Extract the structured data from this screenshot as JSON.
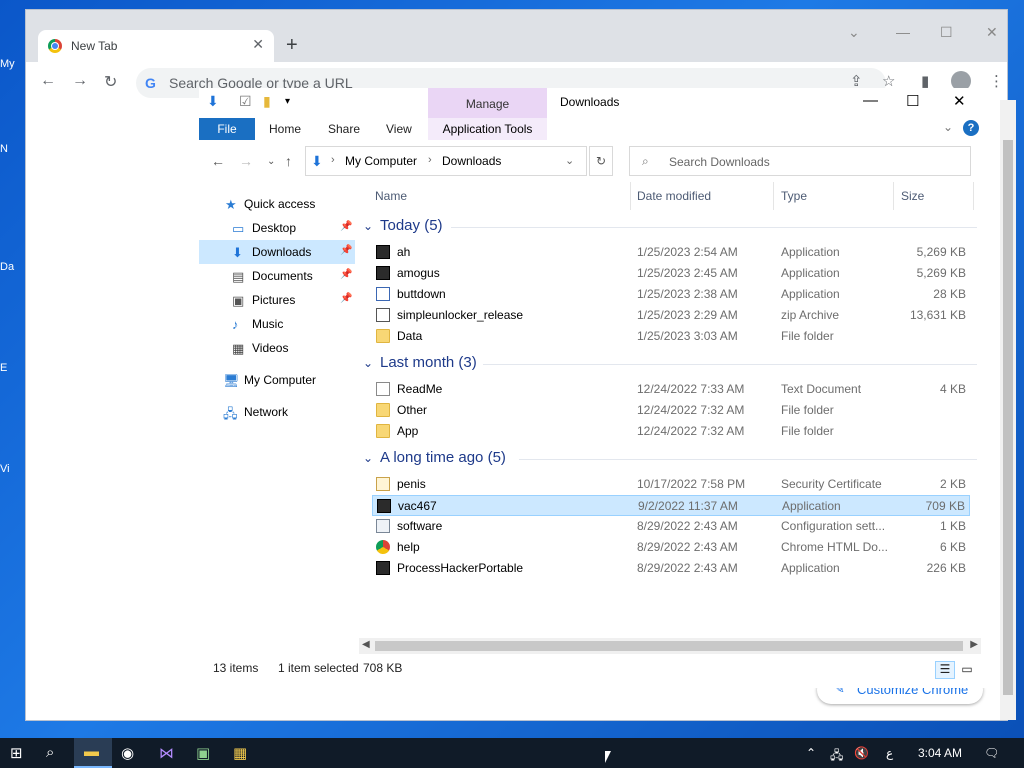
{
  "desktop": {
    "labels": [
      "My",
      "N",
      "Da",
      "E",
      "Vi"
    ]
  },
  "chrome": {
    "tab_title": "New Tab",
    "new_tab": "+",
    "search_placeholder": "Search Google or type a URL",
    "customize": "Customize Chrome"
  },
  "explorer": {
    "title": "Downloads",
    "manage": "Manage",
    "ribbon_tabs": [
      "File",
      "Home",
      "Share",
      "View",
      "Application Tools"
    ],
    "address": [
      "My Computer",
      "Downloads"
    ],
    "search_placeholder": "Search Downloads",
    "nav": [
      {
        "label": "Quick access",
        "icon": "star-icon",
        "pinned": false
      },
      {
        "label": "Desktop",
        "icon": "desktop-icon",
        "pinned": true
      },
      {
        "label": "Downloads",
        "icon": "download-icon",
        "pinned": true,
        "selected": true
      },
      {
        "label": "Documents",
        "icon": "documents-icon",
        "pinned": true
      },
      {
        "label": "Pictures",
        "icon": "pictures-icon",
        "pinned": true
      },
      {
        "label": "Music",
        "icon": "music-icon",
        "pinned": false
      },
      {
        "label": "Videos",
        "icon": "videos-icon",
        "pinned": false
      },
      {
        "label": "My Computer",
        "icon": "computer-icon",
        "pinned": false
      },
      {
        "label": "Network",
        "icon": "network-icon",
        "pinned": false
      }
    ],
    "columns": [
      "Name",
      "Date modified",
      "Type",
      "Size"
    ],
    "groups": [
      {
        "label": "Today (5)",
        "files": [
          {
            "name": "ah",
            "date": "1/25/2023 2:54 AM",
            "type": "Application",
            "size": "5,269 KB",
            "icon": "app"
          },
          {
            "name": "amogus",
            "date": "1/25/2023 2:45 AM",
            "type": "Application",
            "size": "5,269 KB",
            "icon": "app"
          },
          {
            "name": "buttdown",
            "date": "1/25/2023 2:38 AM",
            "type": "Application",
            "size": "28 KB",
            "icon": "exe"
          },
          {
            "name": "simpleunlocker_release",
            "date": "1/25/2023 2:29 AM",
            "type": "zip Archive",
            "size": "13,631 KB",
            "icon": "zip"
          },
          {
            "name": "Data",
            "date": "1/25/2023 3:03 AM",
            "type": "File folder",
            "size": "",
            "icon": "folder"
          }
        ]
      },
      {
        "label": "Last month (3)",
        "files": [
          {
            "name": "ReadMe",
            "date": "12/24/2022 7:33 AM",
            "type": "Text Document",
            "size": "4 KB",
            "icon": "doc"
          },
          {
            "name": "Other",
            "date": "12/24/2022 7:32 AM",
            "type": "File folder",
            "size": "",
            "icon": "folder"
          },
          {
            "name": "App",
            "date": "12/24/2022 7:32 AM",
            "type": "File folder",
            "size": "",
            "icon": "folder"
          }
        ]
      },
      {
        "label": "A long time ago (5)",
        "files": [
          {
            "name": "penis",
            "date": "10/17/2022 7:58 PM",
            "type": "Security Certificate",
            "size": "2 KB",
            "icon": "cert"
          },
          {
            "name": "vac467",
            "date": "9/2/2022 11:37 AM",
            "type": "Application",
            "size": "709 KB",
            "icon": "app",
            "selected": true
          },
          {
            "name": "software",
            "date": "8/29/2022 2:43 AM",
            "type": "Configuration sett...",
            "size": "1 KB",
            "icon": "cfg"
          },
          {
            "name": "help",
            "date": "8/29/2022 2:43 AM",
            "type": "Chrome HTML Do...",
            "size": "6 KB",
            "icon": "chrome"
          },
          {
            "name": "ProcessHackerPortable",
            "date": "8/29/2022 2:43 AM",
            "type": "Application",
            "size": "226 KB",
            "icon": "app"
          }
        ]
      }
    ],
    "status": {
      "items": "13 items",
      "selected": "1 item selected",
      "size": "708 KB"
    }
  },
  "taskbar": {
    "clock": "3:04 AM",
    "lang": "ع"
  }
}
